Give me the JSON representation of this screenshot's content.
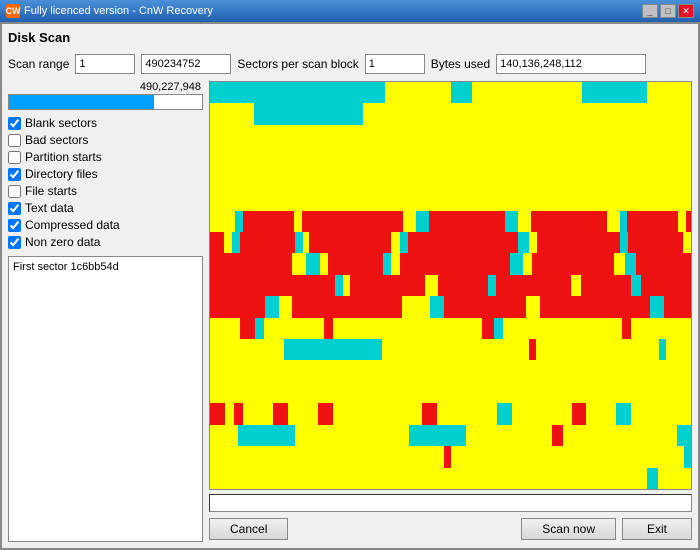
{
  "titleBar": {
    "appTitle": "Fully licenced version - CnW Recovery",
    "icon": "CW",
    "controls": [
      "minimize",
      "maximize",
      "close"
    ]
  },
  "windowTitle": "Disk Scan",
  "scanRange": {
    "label": "Scan range",
    "startValue": "1",
    "endValue": "490234752",
    "sectorsLabel": "Sectors per scan block",
    "sectorsValue": "1",
    "bytesLabel": "Bytes used",
    "bytesValue": "140,136,248,112"
  },
  "progressBar": {
    "value": "490,227,948",
    "fillPercent": 75
  },
  "checkboxes": [
    {
      "label": "Blank sectors",
      "checked": true
    },
    {
      "label": "Bad sectors",
      "checked": false
    },
    {
      "label": "Partition starts",
      "checked": false
    },
    {
      "label": "Directory files",
      "checked": true
    },
    {
      "label": "File starts",
      "checked": false
    },
    {
      "label": "Text data",
      "checked": true
    },
    {
      "label": "Compressed data",
      "checked": true
    },
    {
      "label": "Non zero data",
      "checked": true
    }
  ],
  "infoBox": {
    "text": "First sector 1c6bb54d"
  },
  "buttons": {
    "cancel": "Cancel",
    "scanNow": "Scan now",
    "exit": "Exit"
  }
}
